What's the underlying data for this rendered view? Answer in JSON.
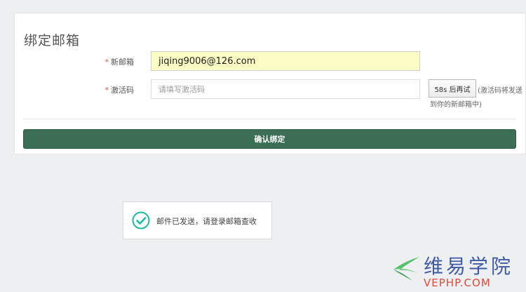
{
  "form": {
    "title": "绑定邮箱",
    "required_mark": "*",
    "email_label": "新邮箱",
    "email_value": "jiqing9006@126.com",
    "code_label": "激活码",
    "code_placeholder": "请填写激活码",
    "resend_label": "58s 后再试",
    "hint_line1": "(激活码将发送",
    "hint_line2": "到你的新邮箱中)",
    "confirm_label": "确认绑定"
  },
  "toast": {
    "message": "邮件已发送，请登录邮箱查收",
    "icon": "check-circle-icon"
  },
  "watermark": {
    "cn_text": "维易学院",
    "en_text": "VEPHP.COM",
    "cn_color": "#3f5aa8",
    "en_color": "#e3483c"
  },
  "colors": {
    "accent": "#3a6e55",
    "required": "#d9534f",
    "email_field_bg": "#fbfcc3",
    "success": "#1abc9c"
  }
}
